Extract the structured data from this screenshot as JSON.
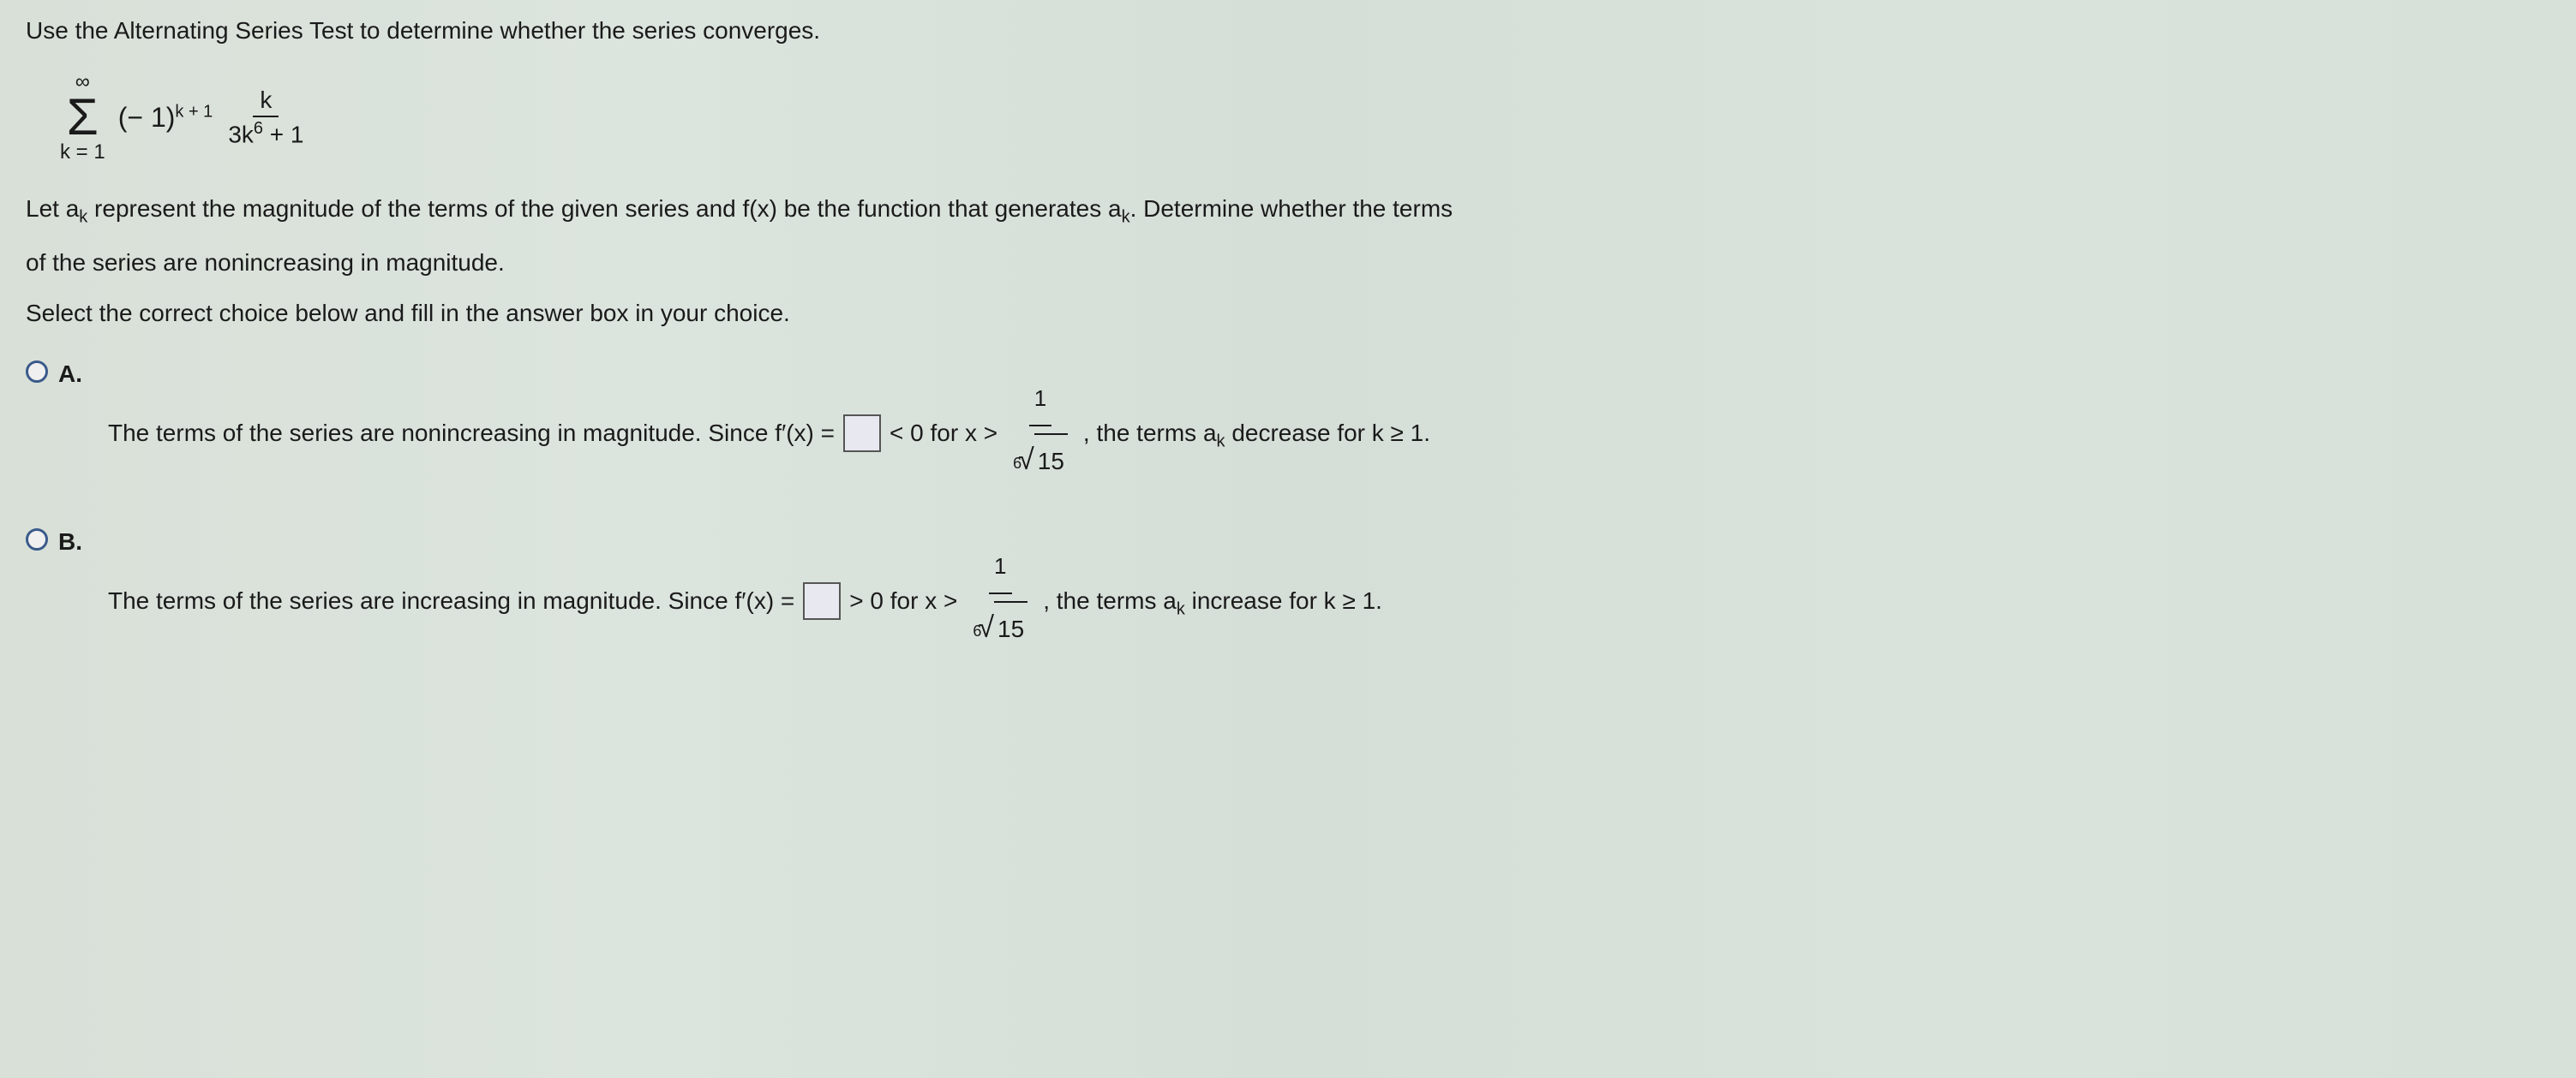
{
  "question": {
    "instruction": "Use the Alternating Series Test to determine whether the series converges.",
    "series": {
      "upper": "∞",
      "lower": "k = 1",
      "coef_base": "(− 1)",
      "coef_exp": "k + 1",
      "frac_num": "k",
      "frac_den_base": "3k",
      "frac_den_exp": "6",
      "frac_den_tail": " + 1"
    },
    "body_line1_pre": "Let a",
    "body_line1_sub": "k",
    "body_line1_mid": " represent the magnitude of the terms of the given series and f(x) be the function that generates a",
    "body_line1_sub2": "k",
    "body_line1_post": ". Determine whether the terms",
    "body_line2": "of the series are nonincreasing in magnitude.",
    "body_line3": "Select the correct choice below and fill in the answer box in your choice."
  },
  "choices": {
    "a": {
      "label": "A.",
      "p1": "The terms of the series are nonincreasing in magnitude. Since f′(x) =",
      "p2": "< 0 for x >",
      "frac_num": "1",
      "root_index": "6",
      "root_content": "15",
      "p3": ", the terms a",
      "sub": "k",
      "p4": " decrease for k ≥ 1."
    },
    "b": {
      "label": "B.",
      "p1": "The terms of the series are increasing in magnitude. Since f′(x) =",
      "p2": "> 0 for x >",
      "frac_num": "1",
      "root_index": "6",
      "root_content": "15",
      "p3": ", the terms a",
      "sub": "k",
      "p4": " increase for k ≥ 1."
    }
  }
}
